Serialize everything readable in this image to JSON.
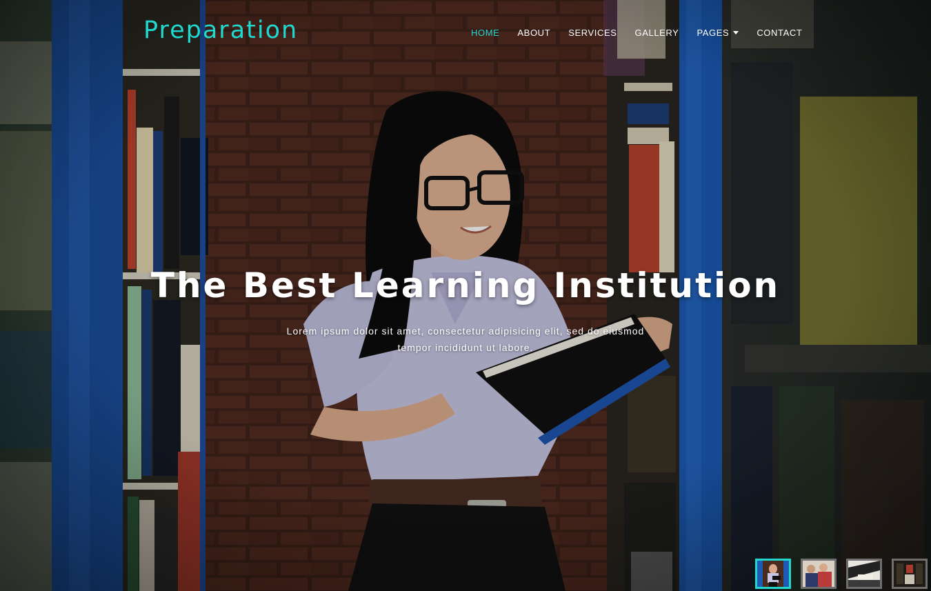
{
  "brand": {
    "name": "Preparation",
    "accent": "#21d8cf"
  },
  "nav": {
    "items": [
      {
        "label": "HOME",
        "active": true
      },
      {
        "label": "ABOUT"
      },
      {
        "label": "SERVICES"
      },
      {
        "label": "GALLERY"
      },
      {
        "label": "PAGES",
        "dropdown": true
      },
      {
        "label": "CONTACT"
      }
    ]
  },
  "hero": {
    "title": "The Best Learning Institution",
    "subtitle_line1": "Lorem ipsum dolor sit amet, consectetur adipisicing elit, sed do eiusmod",
    "subtitle_line2": "tempor incididunt ut labore.",
    "background": "student-reading-in-library"
  },
  "slider": {
    "active_index": 0,
    "thumbnails": [
      "student-reading-thumb",
      "students-group-thumb",
      "writing-thumb",
      "library-thumb"
    ]
  }
}
